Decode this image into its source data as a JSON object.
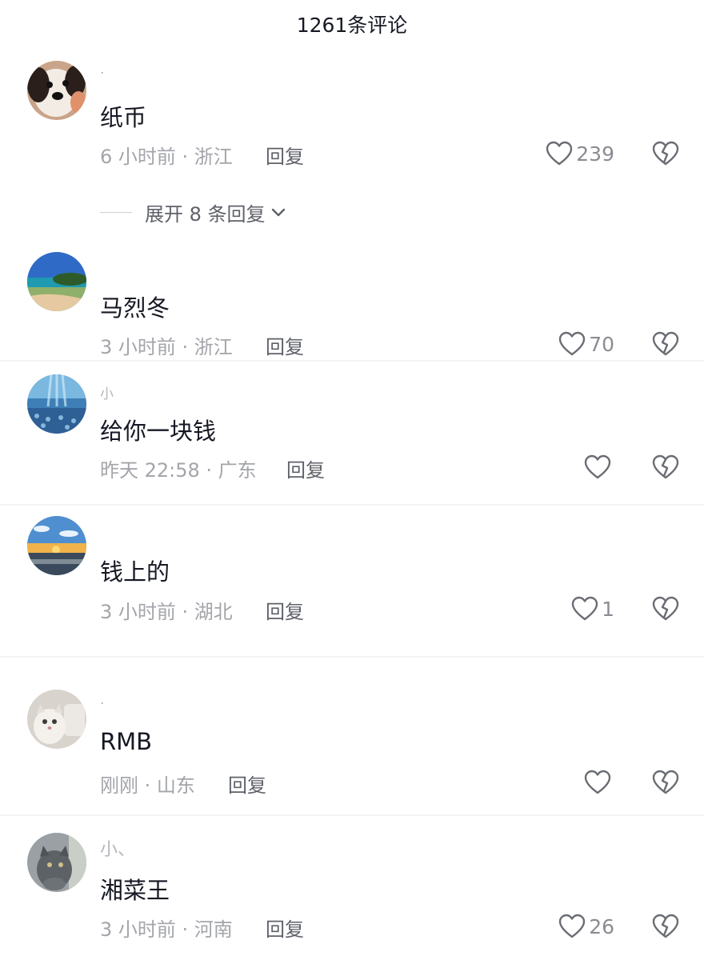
{
  "header": {
    "title": "1261条评论"
  },
  "comments": [
    {
      "username": "·",
      "content": "纸币",
      "meta": "6 小时前 · 浙江",
      "reply_label": "回复",
      "likes": "239"
    },
    {
      "username": "",
      "content": "马烈冬",
      "meta": "3 小时前 · 浙江",
      "reply_label": "回复",
      "likes": "70"
    },
    {
      "username": "小",
      "content": "给你一块钱",
      "meta": "昨天 22:58 · 广东",
      "reply_label": "回复",
      "likes": ""
    },
    {
      "username": "",
      "content": "钱上的",
      "meta": "3 小时前 · 湖北",
      "reply_label": "回复",
      "likes": "1"
    },
    {
      "username": "·",
      "content": "RMB",
      "meta": "刚刚 · 山东",
      "reply_label": "回复",
      "likes": ""
    },
    {
      "username": "小、",
      "content": "湘菜王",
      "meta": "3 小时前 · 河南",
      "reply_label": "回复",
      "likes": "26"
    }
  ],
  "expand_replies": {
    "label": "展开 8 条回复"
  },
  "icons": {
    "like": "heart-outline-icon",
    "dislike": "broken-heart-icon",
    "expand": "chevron-down-icon"
  },
  "colors": {
    "text": "#161823",
    "meta": "#a3a5aa",
    "reply": "#5f6169",
    "icon": "#6b6d74"
  }
}
